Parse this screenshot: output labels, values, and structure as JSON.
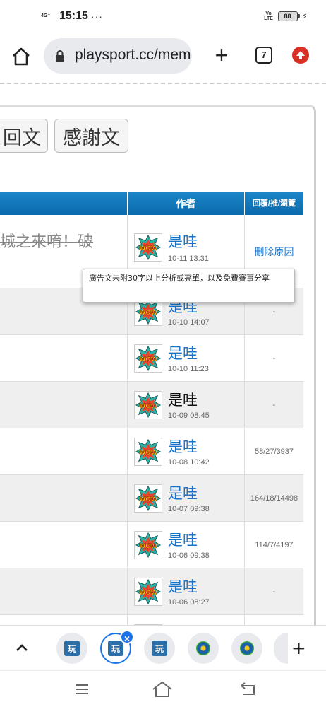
{
  "status_bar": {
    "network": "4G⁺",
    "time": "15:15",
    "dots": "···",
    "volte": "Vo LTE",
    "battery": "88"
  },
  "browser": {
    "url": "playsport.cc/mem",
    "tab_count": "7"
  },
  "post_buttons": {
    "reply": "回文",
    "thanks": "感謝文"
  },
  "table": {
    "headers": {
      "author": "作者",
      "stats": "回覆/推/瀏覽"
    },
    "first_title": "城之來唷！破",
    "tooltip": "廣告文未附30字以上分析或亮單，以及免費賽事分享",
    "rows": [
      {
        "author": "是哇",
        "date": "10-11 13:31",
        "stats": "刪除原因"
      },
      {
        "author": "是哇",
        "date": "10-10 14:07",
        "stats": "-"
      },
      {
        "author": "是哇",
        "date": "10-10 11:23",
        "stats": "-"
      },
      {
        "author": "是哇",
        "date": "10-09 08:45",
        "stats": "-"
      },
      {
        "author": "是哇",
        "date": "10-08 10:42",
        "stats": "58/27/3937"
      },
      {
        "author": "是哇",
        "date": "10-07 09:38",
        "stats": "164/18/14498"
      },
      {
        "author": "是哇",
        "date": "10-06 09:38",
        "stats": "114/7/4197"
      },
      {
        "author": "是哇",
        "date": "10-06 08:27",
        "stats": "-"
      },
      {
        "author": "是哇",
        "date": "",
        "stats": ""
      }
    ]
  },
  "tab_strip": {
    "wan_label": "玩",
    "close_badge": "×",
    "plus": "+"
  },
  "colors": {
    "header_blue": "#0b6aab",
    "link_blue": "#1a73c8",
    "chrome_accent": "#1a73e8",
    "update_red": "#d93025"
  }
}
